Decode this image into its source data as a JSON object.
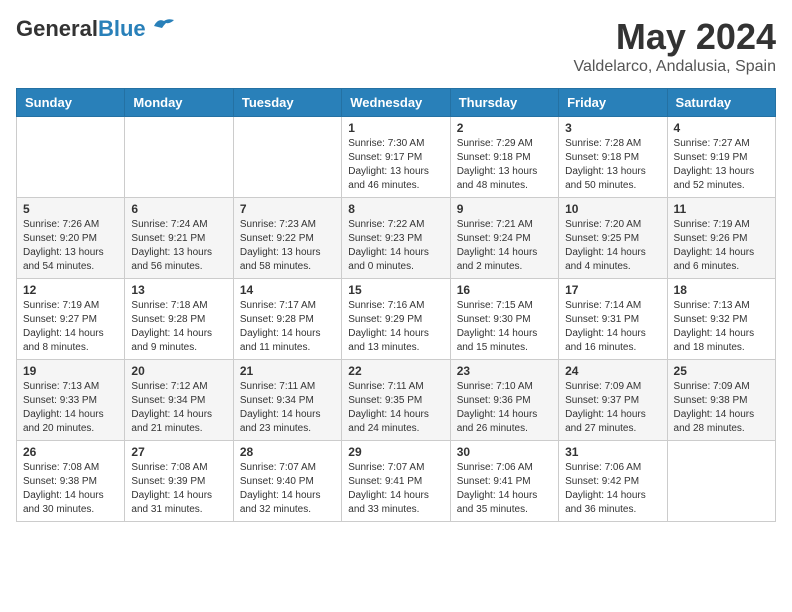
{
  "header": {
    "logo_general": "General",
    "logo_blue": "Blue",
    "month_title": "May 2024",
    "location": "Valdelarco, Andalusia, Spain"
  },
  "days_of_week": [
    "Sunday",
    "Monday",
    "Tuesday",
    "Wednesday",
    "Thursday",
    "Friday",
    "Saturday"
  ],
  "weeks": [
    [
      {
        "day": "",
        "sunrise": "",
        "sunset": "",
        "daylight": ""
      },
      {
        "day": "",
        "sunrise": "",
        "sunset": "",
        "daylight": ""
      },
      {
        "day": "",
        "sunrise": "",
        "sunset": "",
        "daylight": ""
      },
      {
        "day": "1",
        "sunrise": "Sunrise: 7:30 AM",
        "sunset": "Sunset: 9:17 PM",
        "daylight": "Daylight: 13 hours and 46 minutes."
      },
      {
        "day": "2",
        "sunrise": "Sunrise: 7:29 AM",
        "sunset": "Sunset: 9:18 PM",
        "daylight": "Daylight: 13 hours and 48 minutes."
      },
      {
        "day": "3",
        "sunrise": "Sunrise: 7:28 AM",
        "sunset": "Sunset: 9:18 PM",
        "daylight": "Daylight: 13 hours and 50 minutes."
      },
      {
        "day": "4",
        "sunrise": "Sunrise: 7:27 AM",
        "sunset": "Sunset: 9:19 PM",
        "daylight": "Daylight: 13 hours and 52 minutes."
      }
    ],
    [
      {
        "day": "5",
        "sunrise": "Sunrise: 7:26 AM",
        "sunset": "Sunset: 9:20 PM",
        "daylight": "Daylight: 13 hours and 54 minutes."
      },
      {
        "day": "6",
        "sunrise": "Sunrise: 7:24 AM",
        "sunset": "Sunset: 9:21 PM",
        "daylight": "Daylight: 13 hours and 56 minutes."
      },
      {
        "day": "7",
        "sunrise": "Sunrise: 7:23 AM",
        "sunset": "Sunset: 9:22 PM",
        "daylight": "Daylight: 13 hours and 58 minutes."
      },
      {
        "day": "8",
        "sunrise": "Sunrise: 7:22 AM",
        "sunset": "Sunset: 9:23 PM",
        "daylight": "Daylight: 14 hours and 0 minutes."
      },
      {
        "day": "9",
        "sunrise": "Sunrise: 7:21 AM",
        "sunset": "Sunset: 9:24 PM",
        "daylight": "Daylight: 14 hours and 2 minutes."
      },
      {
        "day": "10",
        "sunrise": "Sunrise: 7:20 AM",
        "sunset": "Sunset: 9:25 PM",
        "daylight": "Daylight: 14 hours and 4 minutes."
      },
      {
        "day": "11",
        "sunrise": "Sunrise: 7:19 AM",
        "sunset": "Sunset: 9:26 PM",
        "daylight": "Daylight: 14 hours and 6 minutes."
      }
    ],
    [
      {
        "day": "12",
        "sunrise": "Sunrise: 7:19 AM",
        "sunset": "Sunset: 9:27 PM",
        "daylight": "Daylight: 14 hours and 8 minutes."
      },
      {
        "day": "13",
        "sunrise": "Sunrise: 7:18 AM",
        "sunset": "Sunset: 9:28 PM",
        "daylight": "Daylight: 14 hours and 9 minutes."
      },
      {
        "day": "14",
        "sunrise": "Sunrise: 7:17 AM",
        "sunset": "Sunset: 9:28 PM",
        "daylight": "Daylight: 14 hours and 11 minutes."
      },
      {
        "day": "15",
        "sunrise": "Sunrise: 7:16 AM",
        "sunset": "Sunset: 9:29 PM",
        "daylight": "Daylight: 14 hours and 13 minutes."
      },
      {
        "day": "16",
        "sunrise": "Sunrise: 7:15 AM",
        "sunset": "Sunset: 9:30 PM",
        "daylight": "Daylight: 14 hours and 15 minutes."
      },
      {
        "day": "17",
        "sunrise": "Sunrise: 7:14 AM",
        "sunset": "Sunset: 9:31 PM",
        "daylight": "Daylight: 14 hours and 16 minutes."
      },
      {
        "day": "18",
        "sunrise": "Sunrise: 7:13 AM",
        "sunset": "Sunset: 9:32 PM",
        "daylight": "Daylight: 14 hours and 18 minutes."
      }
    ],
    [
      {
        "day": "19",
        "sunrise": "Sunrise: 7:13 AM",
        "sunset": "Sunset: 9:33 PM",
        "daylight": "Daylight: 14 hours and 20 minutes."
      },
      {
        "day": "20",
        "sunrise": "Sunrise: 7:12 AM",
        "sunset": "Sunset: 9:34 PM",
        "daylight": "Daylight: 14 hours and 21 minutes."
      },
      {
        "day": "21",
        "sunrise": "Sunrise: 7:11 AM",
        "sunset": "Sunset: 9:34 PM",
        "daylight": "Daylight: 14 hours and 23 minutes."
      },
      {
        "day": "22",
        "sunrise": "Sunrise: 7:11 AM",
        "sunset": "Sunset: 9:35 PM",
        "daylight": "Daylight: 14 hours and 24 minutes."
      },
      {
        "day": "23",
        "sunrise": "Sunrise: 7:10 AM",
        "sunset": "Sunset: 9:36 PM",
        "daylight": "Daylight: 14 hours and 26 minutes."
      },
      {
        "day": "24",
        "sunrise": "Sunrise: 7:09 AM",
        "sunset": "Sunset: 9:37 PM",
        "daylight": "Daylight: 14 hours and 27 minutes."
      },
      {
        "day": "25",
        "sunrise": "Sunrise: 7:09 AM",
        "sunset": "Sunset: 9:38 PM",
        "daylight": "Daylight: 14 hours and 28 minutes."
      }
    ],
    [
      {
        "day": "26",
        "sunrise": "Sunrise: 7:08 AM",
        "sunset": "Sunset: 9:38 PM",
        "daylight": "Daylight: 14 hours and 30 minutes."
      },
      {
        "day": "27",
        "sunrise": "Sunrise: 7:08 AM",
        "sunset": "Sunset: 9:39 PM",
        "daylight": "Daylight: 14 hours and 31 minutes."
      },
      {
        "day": "28",
        "sunrise": "Sunrise: 7:07 AM",
        "sunset": "Sunset: 9:40 PM",
        "daylight": "Daylight: 14 hours and 32 minutes."
      },
      {
        "day": "29",
        "sunrise": "Sunrise: 7:07 AM",
        "sunset": "Sunset: 9:41 PM",
        "daylight": "Daylight: 14 hours and 33 minutes."
      },
      {
        "day": "30",
        "sunrise": "Sunrise: 7:06 AM",
        "sunset": "Sunset: 9:41 PM",
        "daylight": "Daylight: 14 hours and 35 minutes."
      },
      {
        "day": "31",
        "sunrise": "Sunrise: 7:06 AM",
        "sunset": "Sunset: 9:42 PM",
        "daylight": "Daylight: 14 hours and 36 minutes."
      },
      {
        "day": "",
        "sunrise": "",
        "sunset": "",
        "daylight": ""
      }
    ]
  ]
}
